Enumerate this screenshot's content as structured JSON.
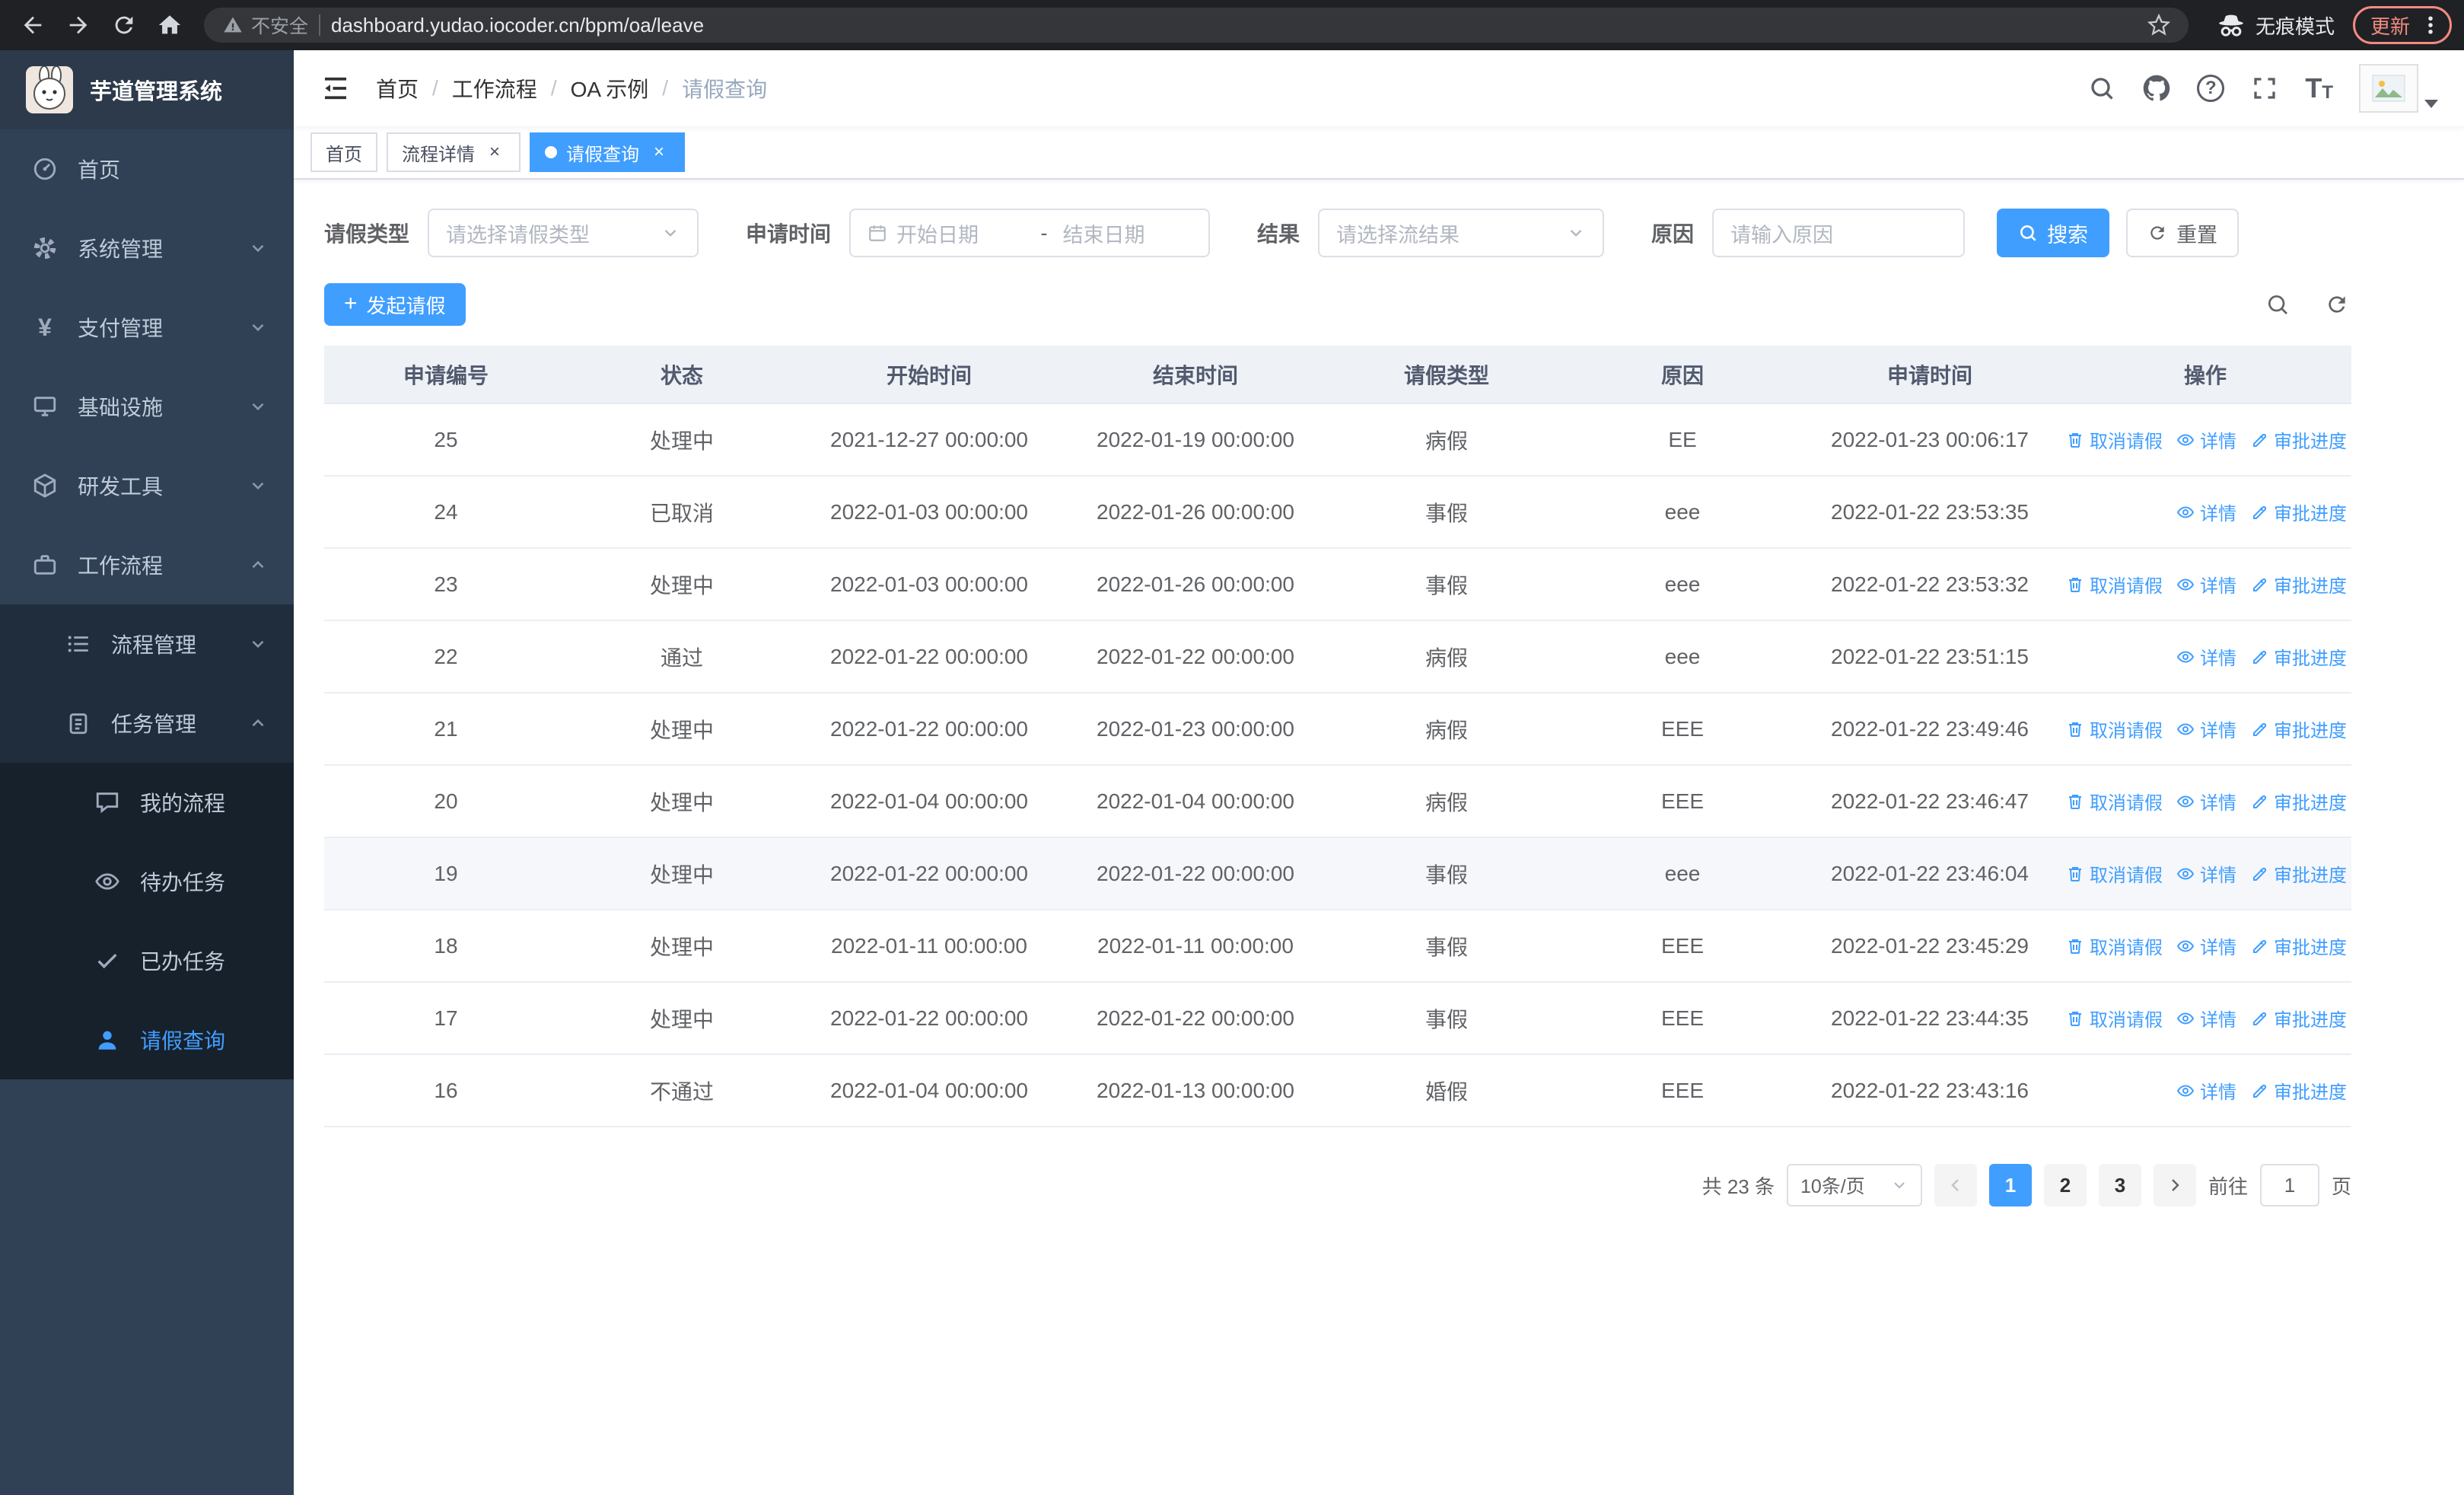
{
  "browser": {
    "security_label": "不安全",
    "url": "dashboard.yudao.iocoder.cn/bpm/oa/leave",
    "incognito_label": "无痕模式",
    "update_label": "更新"
  },
  "sidebar": {
    "title": "芋道管理系统",
    "menu": {
      "home": "首页",
      "system": "系统管理",
      "payment": "支付管理",
      "infra": "基础设施",
      "devtools": "研发工具",
      "workflow": "工作流程",
      "process_mgmt": "流程管理",
      "task_mgmt": "任务管理",
      "my_process": "我的流程",
      "todo_tasks": "待办任务",
      "done_tasks": "已办任务",
      "leave_query": "请假查询"
    }
  },
  "header": {
    "breadcrumb": [
      "首页",
      "工作流程",
      "OA 示例",
      "请假查询"
    ]
  },
  "tabs": [
    {
      "name": "tab-home",
      "label": "首页",
      "closable": false,
      "active": false
    },
    {
      "name": "tab-process-detail",
      "label": "流程详情",
      "closable": true,
      "active": false
    },
    {
      "name": "tab-leave-query",
      "label": "请假查询",
      "closable": true,
      "active": true
    }
  ],
  "filters": {
    "leave_type_label": "请假类型",
    "leave_type_placeholder": "请选择请假类型",
    "apply_time_label": "申请时间",
    "start_date_placeholder": "开始日期",
    "range_separator": "-",
    "end_date_placeholder": "结束日期",
    "result_label": "结果",
    "result_placeholder": "请选择流结果",
    "reason_label": "原因",
    "reason_placeholder": "请输入原因",
    "search_label": "搜索",
    "reset_label": "重置"
  },
  "toolbar": {
    "create_label": "发起请假"
  },
  "table": {
    "columns": [
      "申请编号",
      "状态",
      "开始时间",
      "结束时间",
      "请假类型",
      "原因",
      "申请时间",
      "操作"
    ],
    "action_labels": {
      "cancel": "取消请假",
      "detail": "详情",
      "progress": "审批进度"
    },
    "rows": [
      {
        "id": "25",
        "status": "处理中",
        "start": "2021-12-27 00:00:00",
        "end": "2022-01-19 00:00:00",
        "type": "病假",
        "reason": "EE",
        "apply": "2022-01-23 00:06:17",
        "actions": [
          "cancel",
          "detail",
          "progress"
        ],
        "highlighted": false
      },
      {
        "id": "24",
        "status": "已取消",
        "start": "2022-01-03 00:00:00",
        "end": "2022-01-26 00:00:00",
        "type": "事假",
        "reason": "eee",
        "apply": "2022-01-22 23:53:35",
        "actions": [
          "detail",
          "progress"
        ],
        "highlighted": false
      },
      {
        "id": "23",
        "status": "处理中",
        "start": "2022-01-03 00:00:00",
        "end": "2022-01-26 00:00:00",
        "type": "事假",
        "reason": "eee",
        "apply": "2022-01-22 23:53:32",
        "actions": [
          "cancel",
          "detail",
          "progress"
        ],
        "highlighted": false
      },
      {
        "id": "22",
        "status": "通过",
        "start": "2022-01-22 00:00:00",
        "end": "2022-01-22 00:00:00",
        "type": "病假",
        "reason": "eee",
        "apply": "2022-01-22 23:51:15",
        "actions": [
          "detail",
          "progress"
        ],
        "highlighted": false
      },
      {
        "id": "21",
        "status": "处理中",
        "start": "2022-01-22 00:00:00",
        "end": "2022-01-23 00:00:00",
        "type": "病假",
        "reason": "EEE",
        "apply": "2022-01-22 23:49:46",
        "actions": [
          "cancel",
          "detail",
          "progress"
        ],
        "highlighted": false
      },
      {
        "id": "20",
        "status": "处理中",
        "start": "2022-01-04 00:00:00",
        "end": "2022-01-04 00:00:00",
        "type": "病假",
        "reason": "EEE",
        "apply": "2022-01-22 23:46:47",
        "actions": [
          "cancel",
          "detail",
          "progress"
        ],
        "highlighted": false
      },
      {
        "id": "19",
        "status": "处理中",
        "start": "2022-01-22 00:00:00",
        "end": "2022-01-22 00:00:00",
        "type": "事假",
        "reason": "eee",
        "apply": "2022-01-22 23:46:04",
        "actions": [
          "cancel",
          "detail",
          "progress"
        ],
        "highlighted": true
      },
      {
        "id": "18",
        "status": "处理中",
        "start": "2022-01-11 00:00:00",
        "end": "2022-01-11 00:00:00",
        "type": "事假",
        "reason": "EEE",
        "apply": "2022-01-22 23:45:29",
        "actions": [
          "cancel",
          "detail",
          "progress"
        ],
        "highlighted": false
      },
      {
        "id": "17",
        "status": "处理中",
        "start": "2022-01-22 00:00:00",
        "end": "2022-01-22 00:00:00",
        "type": "事假",
        "reason": "EEE",
        "apply": "2022-01-22 23:44:35",
        "actions": [
          "cancel",
          "detail",
          "progress"
        ],
        "highlighted": false
      },
      {
        "id": "16",
        "status": "不通过",
        "start": "2022-01-04 00:00:00",
        "end": "2022-01-13 00:00:00",
        "type": "婚假",
        "reason": "EEE",
        "apply": "2022-01-22 23:43:16",
        "actions": [
          "detail",
          "progress"
        ],
        "highlighted": false
      }
    ]
  },
  "pagination": {
    "total": "共 23 条",
    "page_size": "10条/页",
    "pages": [
      "1",
      "2",
      "3"
    ],
    "current": "1",
    "goto_label": "前往",
    "goto_value": "1",
    "page_unit": "页"
  },
  "colors": {
    "primary": "#409EFF",
    "sidebar_bg": "#304156"
  }
}
